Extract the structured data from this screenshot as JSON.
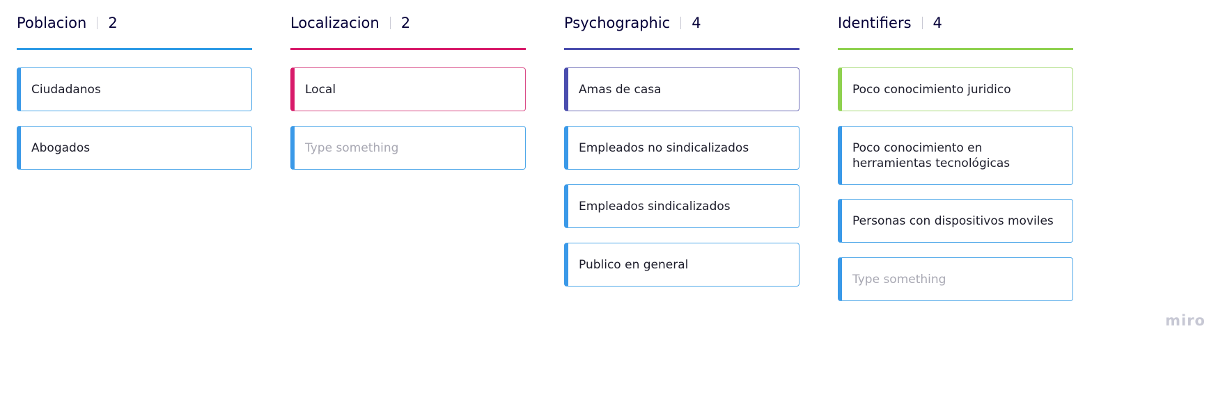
{
  "columns": [
    {
      "title": "Poblacion",
      "count": "2",
      "color": "#2e9be6",
      "cards": [
        {
          "text": "Ciudadanos",
          "accent": "#3a99e8",
          "border": "#4fa8e9",
          "placeholder": false
        },
        {
          "text": "Abogados",
          "accent": "#3a99e8",
          "border": "#4fa8e9",
          "placeholder": false
        }
      ]
    },
    {
      "title": "Localizacion",
      "count": "2",
      "color": "#d81b6a",
      "cards": [
        {
          "text": "Local",
          "accent": "#d81b6a",
          "border": "#d94b86",
          "placeholder": false
        },
        {
          "text": "Type something",
          "accent": "#3a99e8",
          "border": "#4fa8e9",
          "placeholder": true
        }
      ]
    },
    {
      "title": "Psychographic",
      "count": "4",
      "color": "#4a4dae",
      "cards": [
        {
          "text": "Amas de casa",
          "accent": "#4a4dae",
          "border": "#6f6fb8",
          "placeholder": false
        },
        {
          "text": "Empleados no sindicalizados",
          "accent": "#3a99e8",
          "border": "#4fa8e9",
          "placeholder": false
        },
        {
          "text": "Empleados sindicalizados",
          "accent": "#3a99e8",
          "border": "#4fa8e9",
          "placeholder": false
        },
        {
          "text": "Publico en general",
          "accent": "#3a99e8",
          "border": "#4fa8e9",
          "placeholder": false
        }
      ]
    },
    {
      "title": "Identifiers",
      "count": "4",
      "color": "#8fd14f",
      "cards": [
        {
          "text": "Poco conocimiento juridico",
          "accent": "#8fd14f",
          "border": "#a9dc7a",
          "placeholder": false
        },
        {
          "text": "Poco conocimiento en herramientas tecnológicas",
          "accent": "#3a99e8",
          "border": "#4fa8e9",
          "placeholder": false
        },
        {
          "text": "Personas con dispositivos moviles",
          "accent": "#3a99e8",
          "border": "#4fa8e9",
          "placeholder": false
        },
        {
          "text": "Type something",
          "accent": "#3a99e8",
          "border": "#4fa8e9",
          "placeholder": true
        }
      ]
    }
  ],
  "watermark": "miro"
}
